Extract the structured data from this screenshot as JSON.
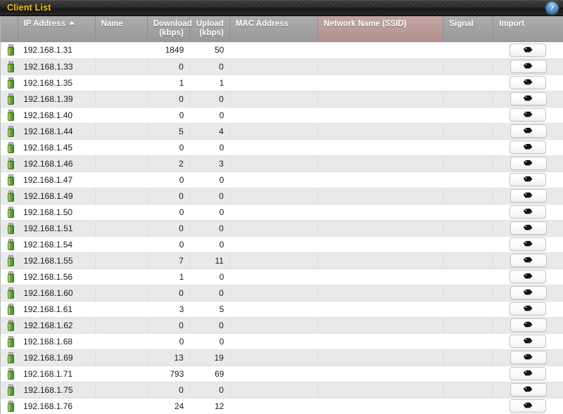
{
  "window": {
    "title": "Client List",
    "help_label": "?",
    "help_icon": "help-circle-icon"
  },
  "table": {
    "columns": [
      {
        "key": "status",
        "label": "",
        "align": "left",
        "hovered": false,
        "sorted": false
      },
      {
        "key": "ip",
        "label": "IP Address",
        "align": "left",
        "hovered": false,
        "sorted": true,
        "sort_dir": "asc"
      },
      {
        "key": "name",
        "label": "Name",
        "align": "left",
        "hovered": false,
        "sorted": false
      },
      {
        "key": "down",
        "label": "Download\n(kbps)",
        "align": "right",
        "hovered": false,
        "sorted": false
      },
      {
        "key": "up",
        "label": "Upload\n(kbps)",
        "align": "right",
        "hovered": false,
        "sorted": false
      },
      {
        "key": "mac",
        "label": "MAC Address",
        "align": "left",
        "hovered": false,
        "sorted": false
      },
      {
        "key": "ssid",
        "label": "Network Name (SSID)",
        "align": "left",
        "hovered": true,
        "sorted": false
      },
      {
        "key": "signal",
        "label": "Signal",
        "align": "left",
        "hovered": false,
        "sorted": false
      },
      {
        "key": "import",
        "label": "Import",
        "align": "left",
        "hovered": false,
        "sorted": false
      }
    ],
    "row_icon": "client-device-icon",
    "import_button_icon": "tag-icon",
    "rows": [
      {
        "ip": "192.168.1.31",
        "name": "",
        "down": "1849",
        "up": "50",
        "mac": "",
        "ssid": "",
        "signal": ""
      },
      {
        "ip": "192.168.1.33",
        "name": "",
        "down": "0",
        "up": "0",
        "mac": "",
        "ssid": "",
        "signal": ""
      },
      {
        "ip": "192.168.1.35",
        "name": "",
        "down": "1",
        "up": "1",
        "mac": "",
        "ssid": "",
        "signal": ""
      },
      {
        "ip": "192.168.1.39",
        "name": "",
        "down": "0",
        "up": "0",
        "mac": "",
        "ssid": "",
        "signal": ""
      },
      {
        "ip": "192.168.1.40",
        "name": "",
        "down": "0",
        "up": "0",
        "mac": "",
        "ssid": "",
        "signal": ""
      },
      {
        "ip": "192.168.1.44",
        "name": "",
        "down": "5",
        "up": "4",
        "mac": "",
        "ssid": "",
        "signal": ""
      },
      {
        "ip": "192.168.1.45",
        "name": "",
        "down": "0",
        "up": "0",
        "mac": "",
        "ssid": "",
        "signal": ""
      },
      {
        "ip": "192.168.1.46",
        "name": "",
        "down": "2",
        "up": "3",
        "mac": "",
        "ssid": "",
        "signal": ""
      },
      {
        "ip": "192.168.1.47",
        "name": "",
        "down": "0",
        "up": "0",
        "mac": "",
        "ssid": "",
        "signal": ""
      },
      {
        "ip": "192.168.1.49",
        "name": "",
        "down": "0",
        "up": "0",
        "mac": "",
        "ssid": "",
        "signal": ""
      },
      {
        "ip": "192.168.1.50",
        "name": "",
        "down": "0",
        "up": "0",
        "mac": "",
        "ssid": "",
        "signal": ""
      },
      {
        "ip": "192.168.1.51",
        "name": "",
        "down": "0",
        "up": "0",
        "mac": "",
        "ssid": "",
        "signal": ""
      },
      {
        "ip": "192.168.1.54",
        "name": "",
        "down": "0",
        "up": "0",
        "mac": "",
        "ssid": "",
        "signal": ""
      },
      {
        "ip": "192.168.1.55",
        "name": "",
        "down": "7",
        "up": "11",
        "mac": "",
        "ssid": "",
        "signal": ""
      },
      {
        "ip": "192.168.1.56",
        "name": "",
        "down": "1",
        "up": "0",
        "mac": "",
        "ssid": "",
        "signal": ""
      },
      {
        "ip": "192.168.1.60",
        "name": "",
        "down": "0",
        "up": "0",
        "mac": "",
        "ssid": "",
        "signal": ""
      },
      {
        "ip": "192.168.1.61",
        "name": "",
        "down": "3",
        "up": "5",
        "mac": "",
        "ssid": "",
        "signal": ""
      },
      {
        "ip": "192.168.1.62",
        "name": "",
        "down": "0",
        "up": "0",
        "mac": "",
        "ssid": "",
        "signal": ""
      },
      {
        "ip": "192.168.1.68",
        "name": "",
        "down": "0",
        "up": "0",
        "mac": "",
        "ssid": "",
        "signal": ""
      },
      {
        "ip": "192.168.1.69",
        "name": "",
        "down": "13",
        "up": "19",
        "mac": "",
        "ssid": "",
        "signal": ""
      },
      {
        "ip": "192.168.1.71",
        "name": "",
        "down": "793",
        "up": "69",
        "mac": "",
        "ssid": "",
        "signal": ""
      },
      {
        "ip": "192.168.1.75",
        "name": "",
        "down": "0",
        "up": "0",
        "mac": "",
        "ssid": "",
        "signal": ""
      },
      {
        "ip": "192.168.1.76",
        "name": "",
        "down": "24",
        "up": "12",
        "mac": "",
        "ssid": "",
        "signal": ""
      }
    ]
  },
  "colors": {
    "title_text": "#f5c518",
    "header_bg": "#a2a2a2",
    "header_hover_bg": "#bb9a9a",
    "row_alt_bg": "#e9e9e9",
    "device_green": "#6aa832",
    "help_blue": "#5590c8"
  }
}
